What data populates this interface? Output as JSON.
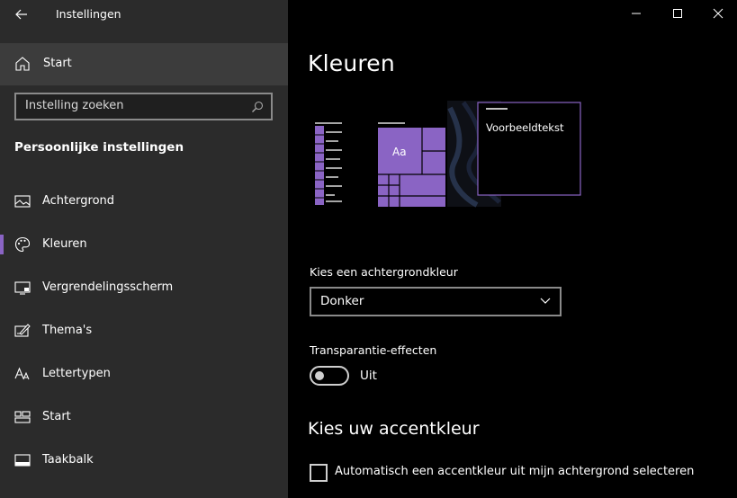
{
  "window": {
    "title": "Instellingen",
    "back_icon": "arrow-left-icon",
    "controls": [
      "minimize-icon",
      "maximize-icon",
      "close-icon"
    ]
  },
  "sidebar": {
    "home_label": "Start",
    "search_placeholder": "Instelling zoeken",
    "section_title": "Persoonlijke instellingen",
    "items": [
      {
        "label": "Achtergrond",
        "icon": "picture-icon",
        "active": false
      },
      {
        "label": "Kleuren",
        "icon": "palette-icon",
        "active": true
      },
      {
        "label": "Vergrendelingsscherm",
        "icon": "monitor-lock-icon",
        "active": false
      },
      {
        "label": "Thema's",
        "icon": "theme-brush-icon",
        "active": false
      },
      {
        "label": "Lettertypen",
        "icon": "font-icon",
        "active": false
      },
      {
        "label": "Start",
        "icon": "start-grid-icon",
        "active": false
      },
      {
        "label": "Taakbalk",
        "icon": "taskbar-icon",
        "active": false
      }
    ]
  },
  "main": {
    "title": "Kleuren",
    "preview": {
      "tile_text": "Aa",
      "sample_text": "Voorbeeldtekst"
    },
    "background_color": {
      "label": "Kies een achtergrondkleur",
      "value": "Donker"
    },
    "transparency": {
      "label": "Transparantie-effecten",
      "state": "Uit",
      "enabled": false
    },
    "accent": {
      "heading": "Kies uw accentkleur",
      "auto_label": "Automatisch een accentkleur uit mijn achtergrond selecteren",
      "auto_checked": false
    }
  },
  "colors": {
    "accent": "#8a64c4",
    "sidebar_bg": "#2b2b2b",
    "main_bg": "#000000"
  }
}
